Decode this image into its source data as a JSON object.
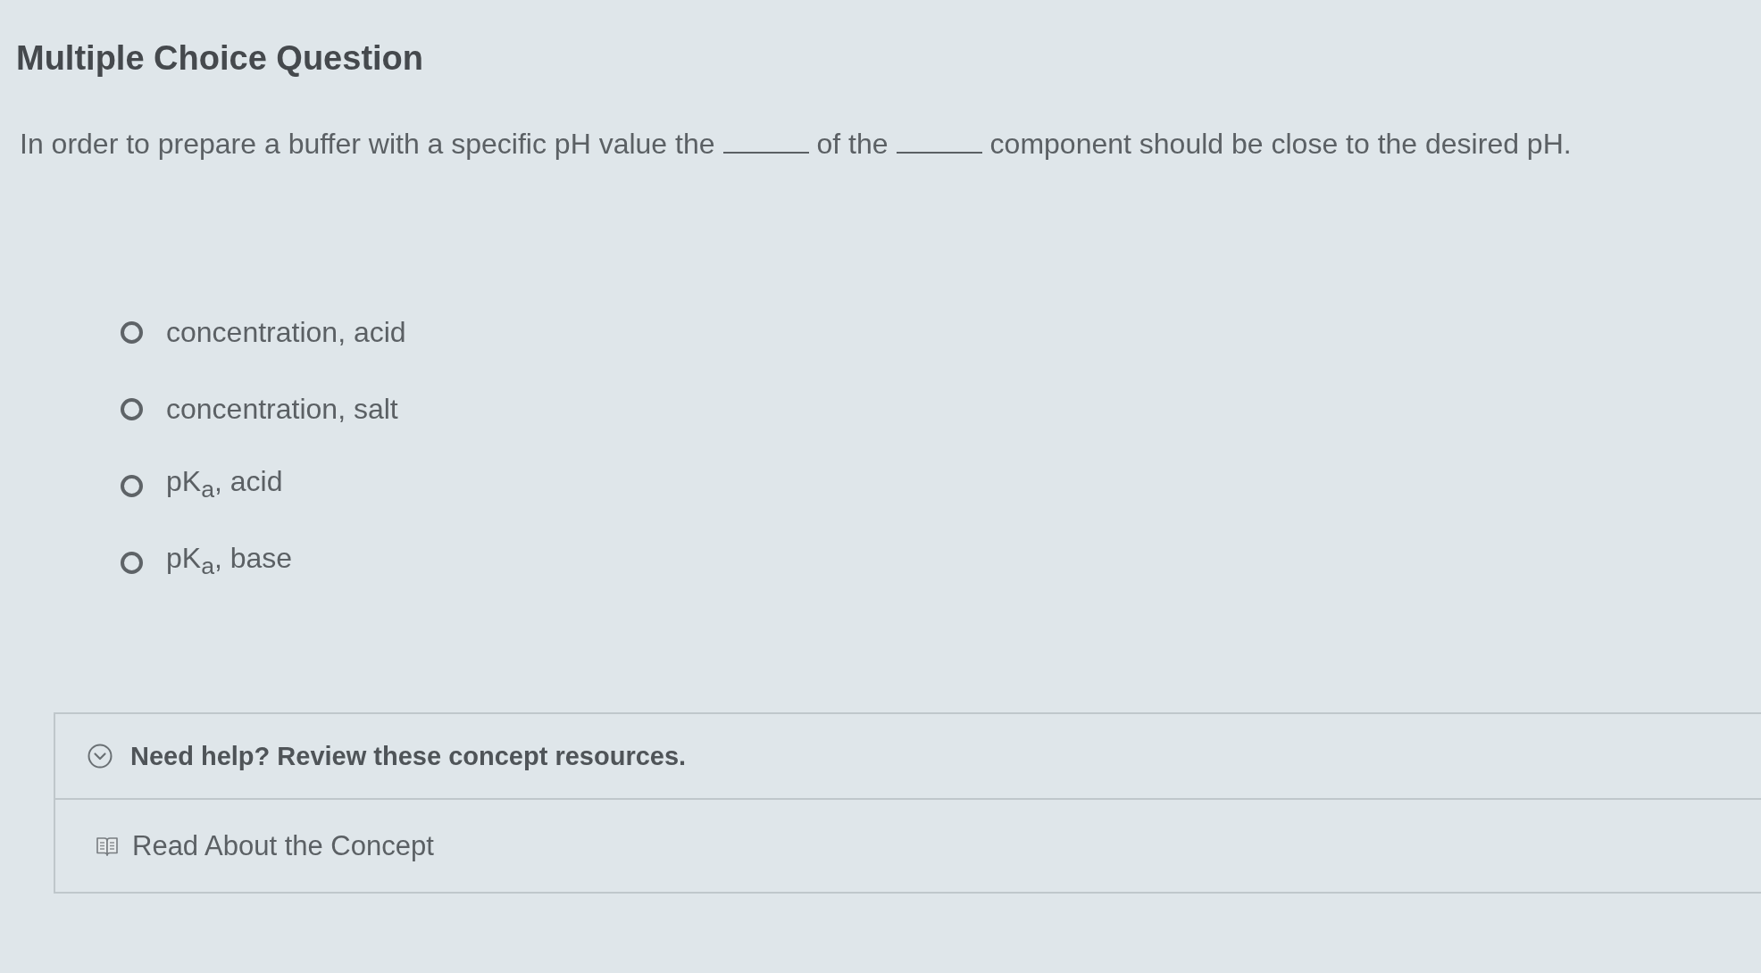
{
  "title": "Multiple Choice Question",
  "question": {
    "parts": [
      {
        "kind": "text",
        "text": "In order to prepare a buffer with a specific pH value the"
      },
      {
        "kind": "blank"
      },
      {
        "kind": "text",
        "text": "of the"
      },
      {
        "kind": "blank"
      },
      {
        "kind": "text",
        "text": "component should be close to the desired pH."
      }
    ]
  },
  "options": [
    {
      "label": "concentration, acid",
      "selected": false
    },
    {
      "label": "concentration, salt",
      "selected": false
    },
    {
      "label": "pK$_{a}$, acid",
      "selected": false
    },
    {
      "label": "pK$_{a}$, base",
      "selected": false
    }
  ],
  "help": {
    "label": "Need help? Review these concept resources.",
    "expanded": true,
    "resources": [
      {
        "label": "Read About the Concept"
      }
    ]
  }
}
